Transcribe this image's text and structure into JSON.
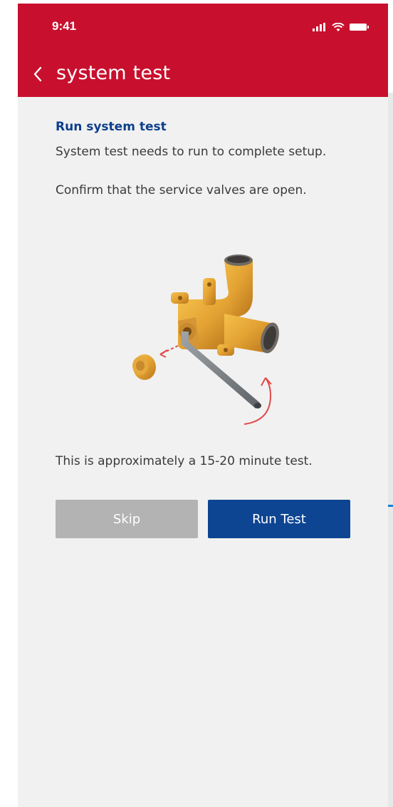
{
  "status_bar": {
    "time": "9:41"
  },
  "nav": {
    "back_icon": "chevron-left-icon",
    "title": "system test"
  },
  "content": {
    "section_title": "Run system test",
    "intro": "System test needs to run to complete setup.",
    "confirm": "Confirm that the service valves are open.",
    "duration": "This is approximately a 15-20 minute test."
  },
  "illustration": {
    "name": "service-valve-with-hex-key"
  },
  "buttons": {
    "skip_label": "Skip",
    "run_label": "Run Test"
  },
  "colors": {
    "header": "#c8102e",
    "primary": "#0d4593",
    "disabled": "#b3b3b3",
    "title_text": "#0d3f8c",
    "background": "#f1f1f1"
  }
}
